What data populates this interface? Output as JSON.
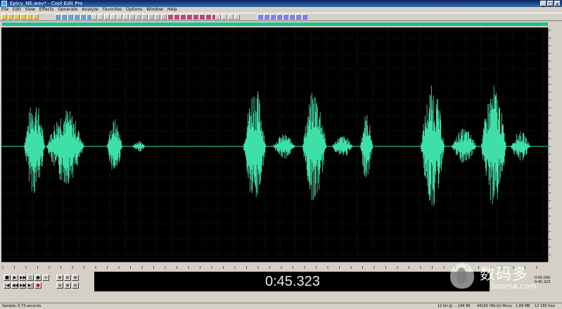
{
  "window": {
    "title": "Epicy_NE.wav* - Cool Edit Pro",
    "min_label": "_",
    "max_label": "□",
    "close_label": "x"
  },
  "menu": [
    "File",
    "Edit",
    "View",
    "Effects",
    "Generate",
    "Analyze",
    "Favorites",
    "Options",
    "Window",
    "Help"
  ],
  "colors": {
    "waveform": "#3fe0a8",
    "background": "#000000",
    "grid": "#1c4a3a",
    "accent_bar": "#19c28c"
  },
  "transport": {
    "row1": [
      "■",
      "▶",
      "▶▶",
      "||",
      "●",
      "∞"
    ],
    "row2": [
      "|◀",
      "◀◀",
      "▶▶",
      "▶|",
      "●"
    ],
    "zoom": [
      "⊕",
      "⊖",
      "⊕",
      "⊖",
      "⊕",
      "⊖"
    ]
  },
  "time_display": "0:45.323",
  "readouts": [
    "0:00.000",
    "0:45.323"
  ],
  "status": {
    "left": "Sample: 0.73 seconds",
    "rate": "12 bit @ ... 16K 8K",
    "format": "44100 ?8b bit Mono",
    "size": "1.89 MB",
    "free": "12 185 free"
  },
  "watermark": {
    "cn": "数码多",
    "en": "Sooma.com"
  }
}
